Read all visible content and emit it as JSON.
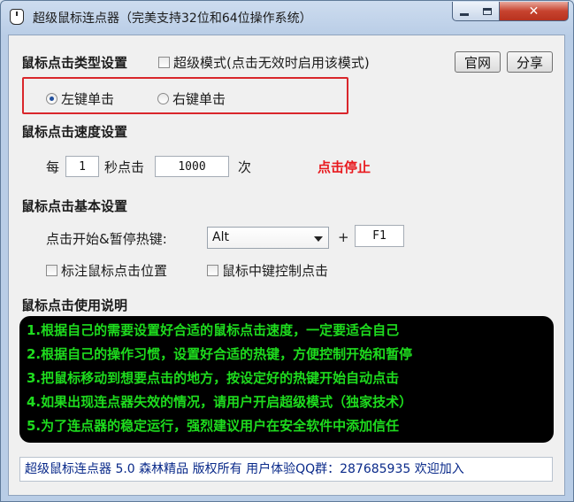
{
  "window": {
    "title": "超级鼠标连点器（完美支持32位和64位操作系统）",
    "controls": {
      "minimize": "—",
      "maximize": "□",
      "close": "✕"
    }
  },
  "click_type": {
    "heading": "鼠标点击类型设置",
    "super_mode_label": "超级模式(点击无效时启用该模式)",
    "super_mode_checked": false,
    "left_click_label": "左键单击",
    "right_click_label": "右键单击",
    "selected": "left"
  },
  "buttons": {
    "official_site": "官网",
    "share": "分享"
  },
  "speed": {
    "heading": "鼠标点击速度设置",
    "prefix": "每",
    "seconds_value": "1",
    "mid": "秒点击",
    "clicks_value": "1000",
    "suffix": "次",
    "stop_label": "点击停止"
  },
  "basic": {
    "heading": "鼠标点击基本设置",
    "hotkey_label": "点击开始&暂停热键:",
    "modifier_value": "Alt",
    "plus": "+",
    "key_value": "F1",
    "mark_position_label": "标注鼠标点击位置",
    "mark_position_checked": false,
    "middle_button_label": "鼠标中键控制点击",
    "middle_button_checked": false
  },
  "instructions": {
    "heading": "鼠标点击使用说明",
    "lines": [
      "1.根据自己的需要设置好合适的鼠标点击速度，一定要适合自己",
      "2.根据自己的操作习惯，设置好合适的热键，方便控制开始和暂停",
      "3.把鼠标移动到想要点击的地方，按设定好的热键开始自动点击",
      "4.如果出现连点器失效的情况，请用户开启超级模式（独家技术）",
      "5.为了连点器的稳定运行，强烈建议用户在安全软件中添加信任"
    ]
  },
  "status_bar": "超级鼠标连点器 5.0 森林精品 版权所有 用户体验QQ群：287685935 欢迎加入",
  "colors": {
    "stop_text": "#e8191e",
    "instruction_text": "#1edb1e",
    "instruction_bg": "#000000",
    "highlight_border": "#d9262b",
    "status_text": "#0a2a8a"
  }
}
